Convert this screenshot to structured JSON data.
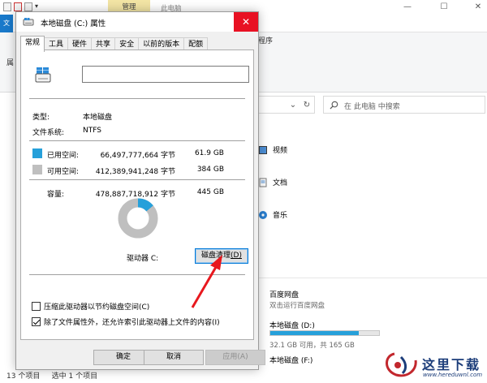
{
  "explorer": {
    "ribbon_tab_manage": "管理",
    "title": "此电脑",
    "file_tab": "文",
    "ribbon_fragment": "程序",
    "ribbon_fragment_left": "属",
    "search_placeholder": "在 此电脑 中搜索",
    "folders": [
      {
        "label": "视频",
        "icon": "video-folder-icon"
      },
      {
        "label": "文档",
        "icon": "document-folder-icon"
      },
      {
        "label": "音乐",
        "icon": "music-folder-icon"
      }
    ],
    "drives": [
      {
        "name": "百度网盘",
        "subtitle": "双击运行百度网盘"
      },
      {
        "name": "本地磁盘 (D:)",
        "free": "32.1 GB 可用，共 165 GB",
        "used_fraction": 0.81
      },
      {
        "name": "本地磁盘 (F:)"
      }
    ],
    "status_items": "13 个项目",
    "status_selected": "选中 1 个项目"
  },
  "dialog": {
    "title": "本地磁盘 (C:) 属性",
    "tabs": [
      "常规",
      "工具",
      "硬件",
      "共享",
      "安全",
      "以前的版本",
      "配额"
    ],
    "active_tab": "常规",
    "name_value": "",
    "type_label": "类型:",
    "type_value": "本地磁盘",
    "fs_label": "文件系统:",
    "fs_value": "NTFS",
    "used_label": "已用空间:",
    "used_bytes": "66,497,777,664 字节",
    "used_gb": "61.9 GB",
    "free_label": "可用空间:",
    "free_bytes": "412,389,941,248 字节",
    "free_gb": "384 GB",
    "capacity_label": "容量:",
    "capacity_bytes": "478,887,718,912 字节",
    "capacity_gb": "445 GB",
    "used_fraction": 0.139,
    "drive_letter": "驱动器 C:",
    "cleanup_label": "磁盘清理",
    "cleanup_key": "(D)",
    "compress_label": "压缩此驱动器以节约磁盘空间(C)",
    "compress_checked": false,
    "index_label": "除了文件属性外，还允许索引此驱动器上文件的内容(I)",
    "index_checked": true,
    "ok_label": "确定",
    "cancel_label": "取消",
    "apply_label": "应用(A)"
  },
  "watermark": {
    "text": "这里下载",
    "url": "www.hereduwnl.com"
  },
  "colors": {
    "used": "#26a0da",
    "free": "#bfbfbf",
    "close_red": "#e81123",
    "highlight_arrow": "#e8181e"
  }
}
